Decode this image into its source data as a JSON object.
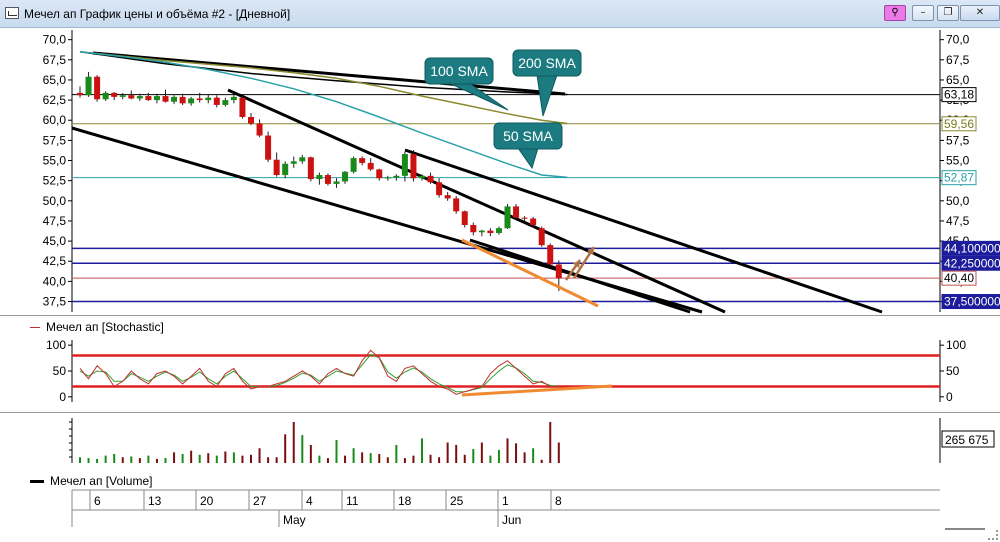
{
  "window": {
    "title": "Мечел ап График цены и объёма #2 - [Дневной]",
    "buttons": {
      "pin": "⚲",
      "minimize": "–",
      "restore": "❐",
      "close": "✕"
    }
  },
  "panels": {
    "stochastic_title": "Мечел ап [Stochastic]",
    "volume_title": "Мечел ап [Volume]"
  },
  "colors": {
    "bull": "#1a8a1a",
    "bear": "#cc1111",
    "volume_bull": "#1a8a1a",
    "volume_bear": "#7a0e0e",
    "level_navy": "#1c1c9c",
    "sma50": "#2aa0a8",
    "sma100": "#8a8a30",
    "sma200": "#000000",
    "callout": "#1b7b80",
    "orange": "#f08a30",
    "stoch_red": "#e02020",
    "stoch_k": "#c03030",
    "stoch_d": "#30a030"
  },
  "chart_data": [
    {
      "type": "candlestick",
      "y_ticks": [
        "70,0",
        "67,5",
        "65,0",
        "62,5",
        "60,0",
        "57,5",
        "55,0",
        "52,5",
        "50,0",
        "47,5",
        "45,0",
        "42,5",
        "40,0",
        "37,5"
      ],
      "y_tick_values": [
        70,
        67.5,
        65,
        62.5,
        60,
        57.5,
        55,
        52.5,
        50,
        47.5,
        45,
        42.5,
        40,
        37.5
      ],
      "ylim": [
        36.2,
        71.2
      ],
      "x_ticks": [
        "6",
        "13",
        "20",
        "27",
        "4",
        "11",
        "18",
        "25",
        "1",
        "8"
      ],
      "x_tick_dates": [
        "2019-05-06",
        "2019-05-13",
        "2019-05-20",
        "2019-05-27",
        "2019-06-04",
        "2019-06-11",
        "2019-06-18",
        "2019-06-25",
        "2019-07-01",
        "2019-07-08"
      ],
      "months": [
        "May",
        "Jun"
      ],
      "candles": [
        [
          63.4,
          64.2,
          62.8,
          63.1
        ],
        [
          63.1,
          66.0,
          62.9,
          65.4
        ],
        [
          65.4,
          65.6,
          62.3,
          62.6
        ],
        [
          62.6,
          63.6,
          62.4,
          63.4
        ],
        [
          63.4,
          63.5,
          62.5,
          62.9
        ],
        [
          62.9,
          63.4,
          62.6,
          63.1
        ],
        [
          63.1,
          63.7,
          62.6,
          62.7
        ],
        [
          62.7,
          63.3,
          62.4,
          63.0
        ],
        [
          63.0,
          63.4,
          62.4,
          62.5
        ],
        [
          62.5,
          63.3,
          62.1,
          63.0
        ],
        [
          63.0,
          63.8,
          62.2,
          62.3
        ],
        [
          62.3,
          63.1,
          62.0,
          62.9
        ],
        [
          62.9,
          63.3,
          61.9,
          62.1
        ],
        [
          62.1,
          62.9,
          61.8,
          62.7
        ],
        [
          62.7,
          63.4,
          62.2,
          62.5
        ],
        [
          62.5,
          63.2,
          62.1,
          62.8
        ],
        [
          62.8,
          63.1,
          61.6,
          61.9
        ],
        [
          61.9,
          62.8,
          61.7,
          62.5
        ],
        [
          62.5,
          63.3,
          62.1,
          62.9
        ],
        [
          62.8,
          63.0,
          60.2,
          60.4
        ],
        [
          60.4,
          60.9,
          59.4,
          59.6
        ],
        [
          59.6,
          60.1,
          57.9,
          58.1
        ],
        [
          58.1,
          58.6,
          54.8,
          55.1
        ],
        [
          55.1,
          56.0,
          53.0,
          53.2
        ],
        [
          53.2,
          54.9,
          52.8,
          54.6
        ],
        [
          54.6,
          55.5,
          54.1,
          54.9
        ],
        [
          54.9,
          55.7,
          54.6,
          55.4
        ],
        [
          55.4,
          55.5,
          52.4,
          52.7
        ],
        [
          52.7,
          53.5,
          52.0,
          53.2
        ],
        [
          53.2,
          53.4,
          51.9,
          52.1
        ],
        [
          52.1,
          52.8,
          51.6,
          52.4
        ],
        [
          52.4,
          53.7,
          52.1,
          53.6
        ],
        [
          53.6,
          55.5,
          53.4,
          55.3
        ],
        [
          55.3,
          55.5,
          54.4,
          54.7
        ],
        [
          54.7,
          55.3,
          53.7,
          53.9
        ],
        [
          53.9,
          54.0,
          52.5,
          52.8
        ],
        [
          52.8,
          53.1,
          52.5,
          52.9
        ],
        [
          52.9,
          53.3,
          52.5,
          53.1
        ],
        [
          53.1,
          56.1,
          52.4,
          55.8
        ],
        [
          55.8,
          56.3,
          52.4,
          52.8
        ],
        [
          52.8,
          53.3,
          52.5,
          53.1
        ],
        [
          53.1,
          53.5,
          52.1,
          52.3
        ],
        [
          52.3,
          52.8,
          50.4,
          50.7
        ],
        [
          50.7,
          51.1,
          50.0,
          50.3
        ],
        [
          50.3,
          50.6,
          48.4,
          48.7
        ],
        [
          48.7,
          48.8,
          46.7,
          47.0
        ],
        [
          47.0,
          47.3,
          45.7,
          46.1
        ],
        [
          46.1,
          46.4,
          45.6,
          46.3
        ],
        [
          46.3,
          46.6,
          45.6,
          46.0
        ],
        [
          46.0,
          46.8,
          45.8,
          46.6
        ],
        [
          46.6,
          49.6,
          46.5,
          49.3
        ],
        [
          49.3,
          49.6,
          47.6,
          47.9
        ],
        [
          47.9,
          48.1,
          47.5,
          47.8
        ],
        [
          47.8,
          48.0,
          46.7,
          47.0
        ],
        [
          46.6,
          46.8,
          44.3,
          44.5
        ],
        [
          44.5,
          44.7,
          41.8,
          42.1
        ],
        [
          42.1,
          42.6,
          38.8,
          40.4
        ]
      ],
      "sma50": [
        [
          0,
          68.5
        ],
        [
          5,
          67.9
        ],
        [
          10,
          67.2
        ],
        [
          15,
          66.3
        ],
        [
          20,
          65.2
        ],
        [
          25,
          63.9
        ],
        [
          30,
          62.3
        ],
        [
          35,
          60.4
        ],
        [
          40,
          58.4
        ],
        [
          45,
          56.5
        ],
        [
          50,
          54.6
        ],
        [
          54,
          53.2
        ],
        [
          57,
          52.9
        ]
      ],
      "sma100": [
        [
          0,
          68.5
        ],
        [
          10,
          67.4
        ],
        [
          20,
          66.5
        ],
        [
          25,
          65.9
        ],
        [
          30,
          65.2
        ],
        [
          35,
          64.2
        ],
        [
          40,
          63.0
        ],
        [
          45,
          61.9
        ],
        [
          50,
          60.8
        ],
        [
          54,
          60.0
        ],
        [
          57,
          59.6
        ]
      ],
      "sma200": [
        [
          0,
          68.5
        ],
        [
          10,
          67.0
        ],
        [
          20,
          65.8
        ],
        [
          30,
          64.9
        ],
        [
          40,
          64.1
        ],
        [
          50,
          63.5
        ],
        [
          57,
          63.2
        ]
      ],
      "horizontal_levels": [
        {
          "value": 63.18,
          "label": "63,18",
          "kind": "sma200_value"
        },
        {
          "value": 59.56,
          "label": "59,56",
          "kind": "sma100_value"
        },
        {
          "value": 52.87,
          "label": "52,87",
          "kind": "sma50_value"
        },
        {
          "value": 44.1,
          "label": "44,100000",
          "kind": "support"
        },
        {
          "value": 42.25,
          "label": "42,250000",
          "kind": "support"
        },
        {
          "value": 40.4,
          "label": "40,40",
          "kind": "last_price"
        },
        {
          "value": 37.5,
          "label": "37,500000",
          "kind": "support"
        }
      ],
      "callouts": [
        {
          "text": "100 SMA"
        },
        {
          "text": "200 SMA"
        },
        {
          "text": "50 SMA"
        }
      ]
    },
    {
      "type": "line",
      "name": "Мечел ап [Stochastic]",
      "y_ticks": [
        "100",
        "50",
        "0"
      ],
      "ylim": [
        -10,
        110
      ],
      "levels": [
        80,
        20
      ],
      "k": [
        55,
        35,
        60,
        45,
        20,
        30,
        50,
        35,
        25,
        45,
        50,
        40,
        25,
        40,
        55,
        30,
        20,
        45,
        55,
        30,
        15,
        20,
        20,
        25,
        30,
        40,
        50,
        40,
        25,
        45,
        55,
        45,
        40,
        70,
        90,
        75,
        40,
        30,
        55,
        60,
        45,
        30,
        20,
        15,
        5,
        10,
        15,
        20,
        45,
        60,
        70,
        55,
        40,
        25,
        30,
        20,
        20
      ],
      "d": [
        50,
        40,
        50,
        48,
        30,
        30,
        45,
        38,
        30,
        40,
        48,
        42,
        30,
        38,
        48,
        35,
        25,
        40,
        50,
        35,
        20,
        20,
        20,
        22,
        28,
        36,
        46,
        42,
        30,
        40,
        50,
        46,
        42,
        62,
        82,
        76,
        48,
        36,
        48,
        56,
        48,
        35,
        25,
        18,
        10,
        10,
        14,
        18,
        35,
        50,
        62,
        56,
        45,
        30,
        28,
        22,
        20
      ]
    },
    {
      "type": "bar",
      "name": "Мечел ап [Volume]",
      "last_value_label": "265 675",
      "values": [
        14,
        12,
        10,
        18,
        22,
        14,
        16,
        12,
        18,
        10,
        12,
        26,
        22,
        30,
        20,
        24,
        18,
        28,
        26,
        18,
        20,
        36,
        14,
        14,
        70,
        100,
        68,
        44,
        18,
        12,
        56,
        18,
        36,
        26,
        24,
        22,
        14,
        44,
        12,
        18,
        60,
        20,
        14,
        50,
        44,
        20,
        34,
        50,
        18,
        32,
        60,
        48,
        26,
        36,
        8,
        100,
        50
      ],
      "bull": [
        1,
        1,
        1,
        1,
        1,
        0,
        1,
        0,
        1,
        0,
        1,
        0,
        1,
        0,
        1,
        0,
        1,
        0,
        1,
        0,
        0,
        0,
        0,
        0,
        0,
        0,
        1,
        0,
        1,
        0,
        1,
        0,
        1,
        0,
        1,
        0,
        0,
        1,
        0,
        0,
        1,
        0,
        0,
        0,
        0,
        0,
        1,
        0,
        1,
        1,
        0,
        0,
        0,
        1,
        0,
        0,
        0
      ]
    }
  ]
}
